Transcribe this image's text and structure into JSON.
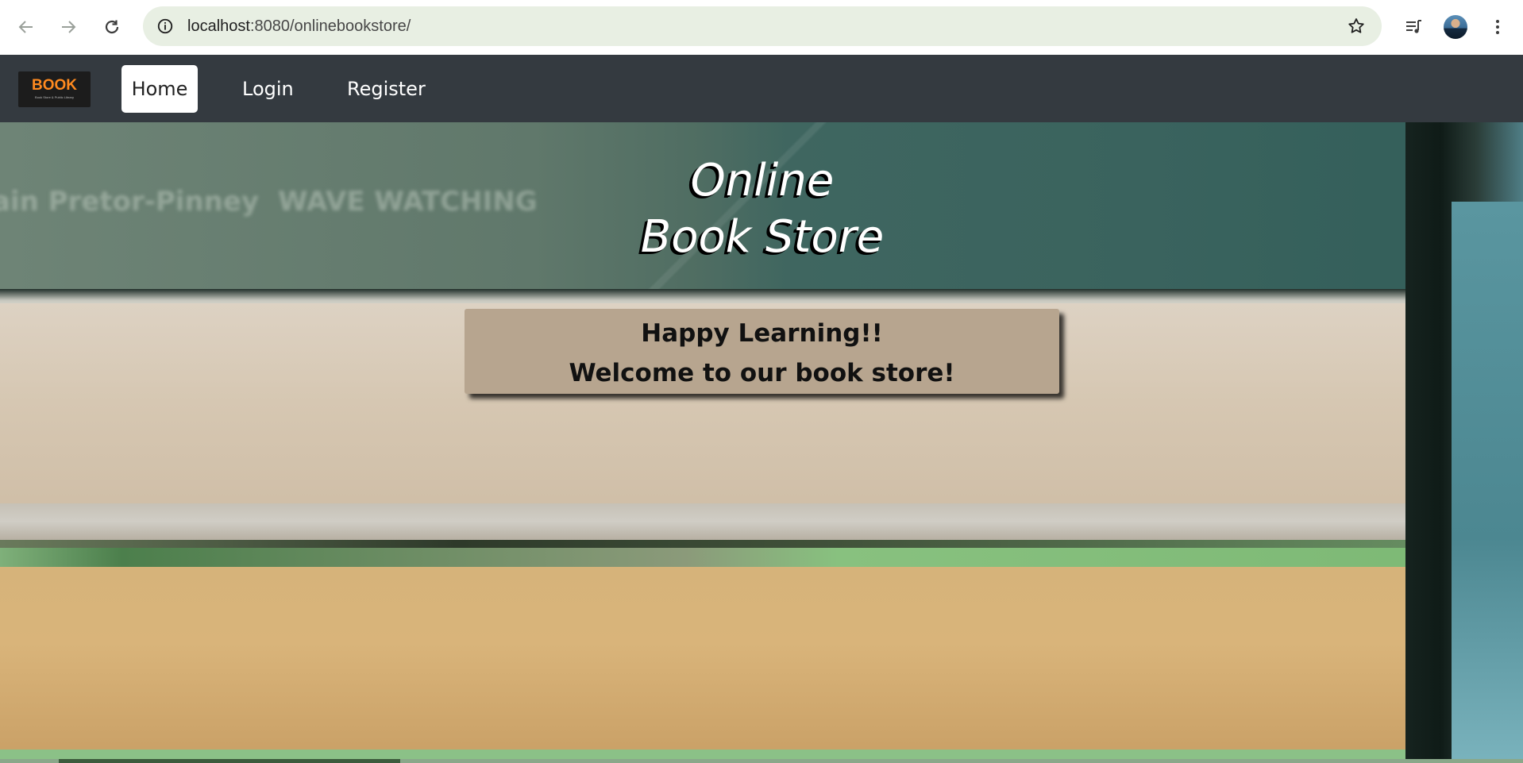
{
  "browser": {
    "url_host": "localhost",
    "url_rest": ":8080/onlinebookstore/",
    "icons": {
      "back": "arrow-left-icon",
      "forward": "arrow-right-icon",
      "reload": "reload-icon",
      "site_info": "info-icon",
      "bookmark": "star-icon",
      "media": "media-queue-icon",
      "profile": "avatar",
      "menu": "kebab-menu-icon"
    }
  },
  "navbar": {
    "logo_word": "BOOK",
    "logo_tagline": "Book Store & Public Library",
    "links": [
      {
        "label": "Home",
        "active": true
      },
      {
        "label": "Login",
        "active": false
      },
      {
        "label": "Register",
        "active": false
      }
    ],
    "colors": {
      "background": "#343a40",
      "active_bg": "#ffffff",
      "text": "#ffffff"
    }
  },
  "hero": {
    "title_line1": "Online",
    "title_line2": "Book Store",
    "welcome_line1": "Happy Learning!!",
    "welcome_line2": "Welcome to our book store!",
    "background_text": [
      "ain Pretor-Pinney",
      "WAVE WATCHING"
    ]
  }
}
